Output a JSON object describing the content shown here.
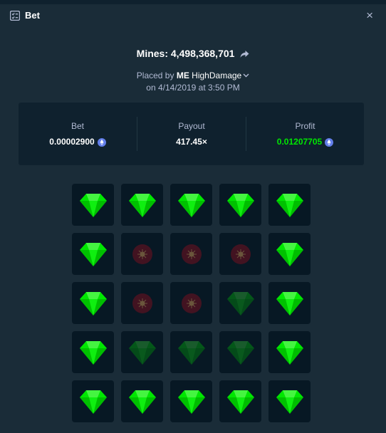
{
  "header": {
    "title": "Bet",
    "close": "×"
  },
  "game": {
    "title": "Mines: 4,498,368,701",
    "placed_prefix": "Placed by",
    "user_prefix": "ME",
    "username": "HighDamage",
    "date": "on 4/14/2019 at 3:50 PM"
  },
  "stats": [
    {
      "label": "Bet",
      "value": "0.00002900",
      "currency_icon": "ethereum-icon",
      "color": "#ffffff"
    },
    {
      "label": "Payout",
      "value": "417.45×",
      "color": "#ffffff"
    },
    {
      "label": "Profit",
      "value": "0.01207705",
      "currency_icon": "ethereum-icon",
      "color": "#00e701"
    }
  ],
  "colors": {
    "gem": "#00e701",
    "mine": "#8a0f1e",
    "background": "#1a2c38",
    "panel": "#0f212e",
    "tile": "#071824"
  },
  "grid": {
    "rows": 5,
    "cols": 5,
    "tiles": [
      "gem",
      "gem",
      "gem",
      "gem",
      "gem",
      "gem",
      "mine",
      "mine",
      "mine",
      "gem",
      "gem",
      "mine",
      "mine",
      "gem-dim",
      "gem",
      "gem",
      "gem-dim",
      "gem-dim",
      "gem-dim",
      "gem",
      "gem",
      "gem",
      "gem",
      "gem",
      "gem"
    ]
  }
}
